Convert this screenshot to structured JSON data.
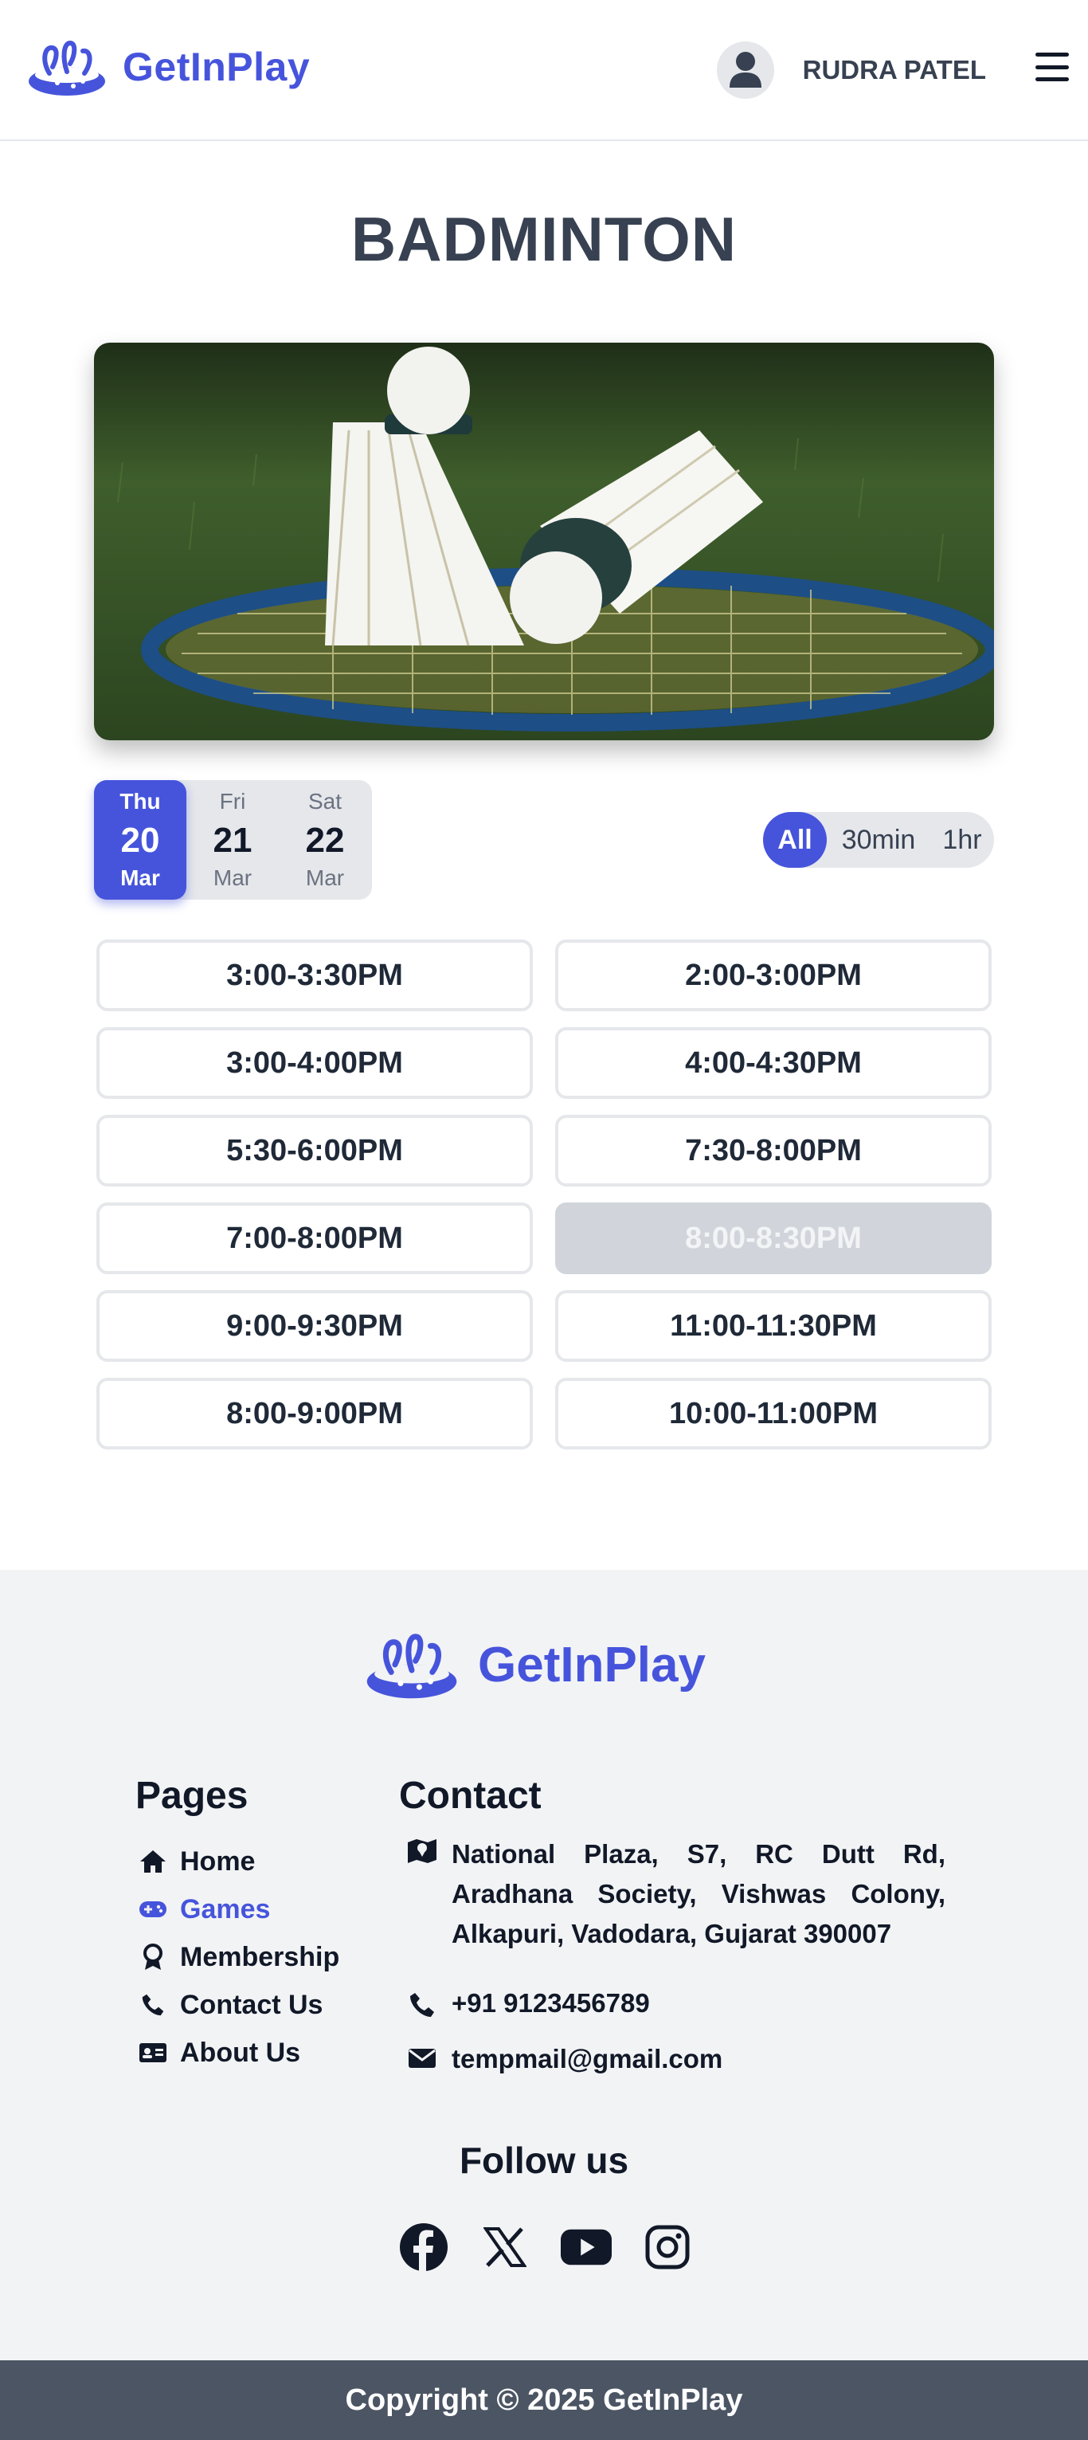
{
  "header": {
    "brand": "GetInPlay",
    "user_name": "RUDRA PATEL"
  },
  "page": {
    "title": "BADMINTON"
  },
  "dates": [
    {
      "dow": "Thu",
      "day": "20",
      "month": "Mar",
      "selected": true
    },
    {
      "dow": "Fri",
      "day": "21",
      "month": "Mar",
      "selected": false
    },
    {
      "dow": "Sat",
      "day": "22",
      "month": "Mar",
      "selected": false
    }
  ],
  "filters": [
    {
      "label": "All",
      "selected": true
    },
    {
      "label": "30min",
      "selected": false
    },
    {
      "label": "1hr",
      "selected": false
    }
  ],
  "slots": [
    {
      "label": "3:00-3:30PM",
      "available": true
    },
    {
      "label": "2:00-3:00PM",
      "available": true
    },
    {
      "label": "3:00-4:00PM",
      "available": true
    },
    {
      "label": "4:00-4:30PM",
      "available": true
    },
    {
      "label": "5:30-6:00PM",
      "available": true
    },
    {
      "label": "7:30-8:00PM",
      "available": true
    },
    {
      "label": "7:00-8:00PM",
      "available": true
    },
    {
      "label": "8:00-8:30PM",
      "available": false
    },
    {
      "label": "9:00-9:30PM",
      "available": true
    },
    {
      "label": "11:00-11:30PM",
      "available": true
    },
    {
      "label": "8:00-9:00PM",
      "available": true
    },
    {
      "label": "10:00-11:00PM",
      "available": true
    }
  ],
  "footer": {
    "brand": "GetInPlay",
    "pages_title": "Pages",
    "pages": [
      {
        "label": "Home",
        "icon": "home-icon",
        "active": false
      },
      {
        "label": "Games",
        "icon": "gamepad-icon",
        "active": true
      },
      {
        "label": "Membership",
        "icon": "award-icon",
        "active": false
      },
      {
        "label": "Contact Us",
        "icon": "phone-icon",
        "active": false
      },
      {
        "label": "About Us",
        "icon": "id-card-icon",
        "active": false
      }
    ],
    "contact_title": "Contact",
    "address": "National Plaza, S7, RC Dutt Rd, Aradhana Society, Vishwas Colony, Alkapuri, Vadodara, Gujarat 390007",
    "phone": "+91 9123456789",
    "email": "tempmail@gmail.com",
    "follow_title": "Follow us",
    "socials": [
      "facebook-icon",
      "x-icon",
      "youtube-icon",
      "instagram-icon"
    ],
    "copyright": "Copyright © 2025 GetInPlay"
  },
  "colors": {
    "accent": "#4654dc",
    "heading": "#374151",
    "footer_bg": "#f2f3f5",
    "copyright_bg": "#4b5563",
    "disabled_slot": "#d1d5db"
  }
}
